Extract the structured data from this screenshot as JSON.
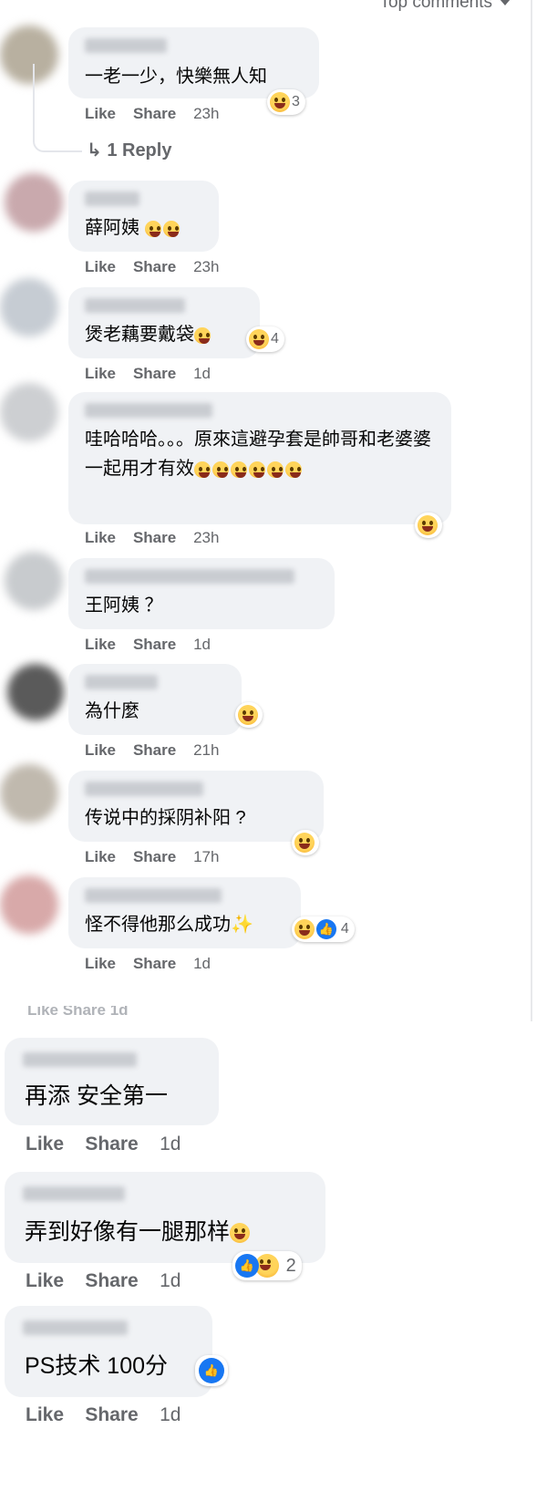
{
  "header": {
    "sort_label": "Top comments"
  },
  "actions": {
    "like": "Like",
    "share": "Share"
  },
  "comments": [
    {
      "text": "一老一少，快樂無人知",
      "time": "23h",
      "reaction_count": "3",
      "reply_label": "↳ 1 Reply"
    },
    {
      "text": "薛阿姨",
      "time": "23h"
    },
    {
      "text": "煲老藕要戴袋",
      "time": "1d",
      "reaction_count": "4"
    },
    {
      "text": "哇哈哈哈。。。原來這避孕套是帥哥和老婆婆一起用才有效",
      "time": "23h"
    },
    {
      "text": "王阿姨 ？",
      "time": "1d"
    },
    {
      "text": "為什麼",
      "time": "21h"
    },
    {
      "text": "传说中的採阴补阳 ?",
      "time": "17h"
    },
    {
      "text": "怪不得他那么成功",
      "time": "1d",
      "reaction_count": "4"
    },
    {
      "text": "再添 安全第一",
      "time": "1d"
    },
    {
      "text": "弄到好像有一腿那样",
      "time": "1d",
      "reaction_count": "2"
    },
    {
      "text": "PS技术 100分",
      "time": "1d"
    }
  ],
  "cut_row": "Like    Share    1d"
}
